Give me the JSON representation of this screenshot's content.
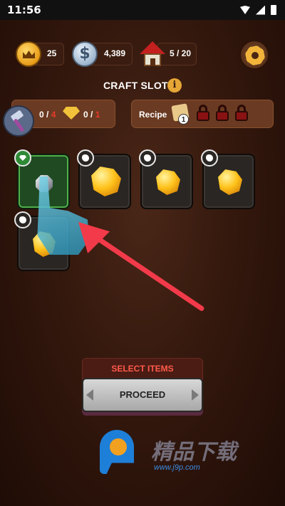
{
  "status_bar": {
    "time": "11:56"
  },
  "resources": {
    "crowns": "25",
    "coins": "4,389",
    "houses": "5 / 20"
  },
  "craft": {
    "title": "CRAFT SLOT",
    "info_icon": "i",
    "requirements": {
      "item_have": "0",
      "item_need": "4",
      "gem_have": "0",
      "gem_need": "1",
      "separator": " / "
    },
    "recipe_label": "Recipe",
    "recipe_count": "1",
    "locked_recipe_slots": 3
  },
  "slots": [
    {
      "badge": "gem",
      "item": "gray-gem",
      "selected": true
    },
    {
      "badge": "ore",
      "item": "gold-nugget",
      "selected": false
    },
    {
      "badge": "ore",
      "item": "gold-nugget",
      "selected": false
    },
    {
      "badge": "ore",
      "item": "gold-nugget",
      "selected": false
    },
    {
      "badge": "ore",
      "item": "gold-nugget",
      "selected": false
    }
  ],
  "actions": {
    "select_items": "SELECT ITEMS",
    "proceed": "PROCEED"
  },
  "watermark": {
    "brand": "精品下载",
    "url": "www.j9p.com"
  },
  "colors": {
    "accent_red": "#f23a4a",
    "selected_slot": "#1f4a22",
    "gold": "#ffc21a"
  }
}
